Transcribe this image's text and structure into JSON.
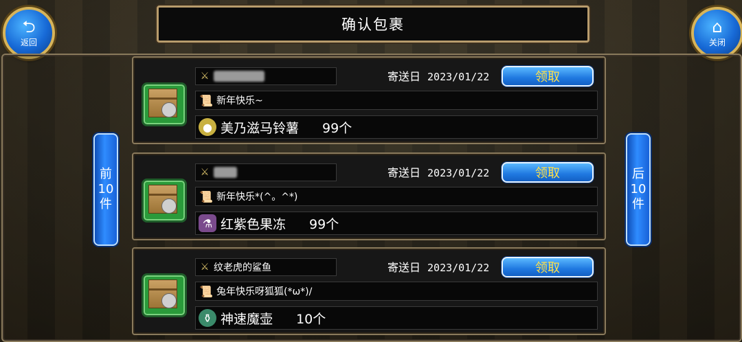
{
  "header": {
    "title": "确认包裹",
    "back_label": "返回",
    "close_label": "关闭"
  },
  "pager": {
    "prev_label_lines": [
      "前",
      "10",
      "件"
    ],
    "next_label_lines": [
      "后",
      "10",
      "件"
    ]
  },
  "packages": [
    {
      "sender": "",
      "sender_hidden": true,
      "date_label": "寄送日",
      "date": "2023/01/22",
      "receive_label": "领取",
      "message": "新年快乐~",
      "item_name": "美乃滋马铃薯",
      "item_count": "99个",
      "item_icon": "potato-icon"
    },
    {
      "sender": "",
      "sender_hidden": true,
      "date_label": "寄送日",
      "date": "2023/01/22",
      "receive_label": "领取",
      "message": "新年快乐*(^。^*)",
      "item_name": "红紫色果冻",
      "item_count": "99个",
      "item_icon": "potion-icon"
    },
    {
      "sender": "纹老虎的鲨鱼",
      "sender_hidden": false,
      "date_label": "寄送日",
      "date": "2023/01/22",
      "receive_label": "领取",
      "message": "兔年快乐呀狐狐(*ω*)/",
      "item_name": "神速魔壶",
      "item_count": "10个",
      "item_icon": "pot-icon"
    }
  ]
}
